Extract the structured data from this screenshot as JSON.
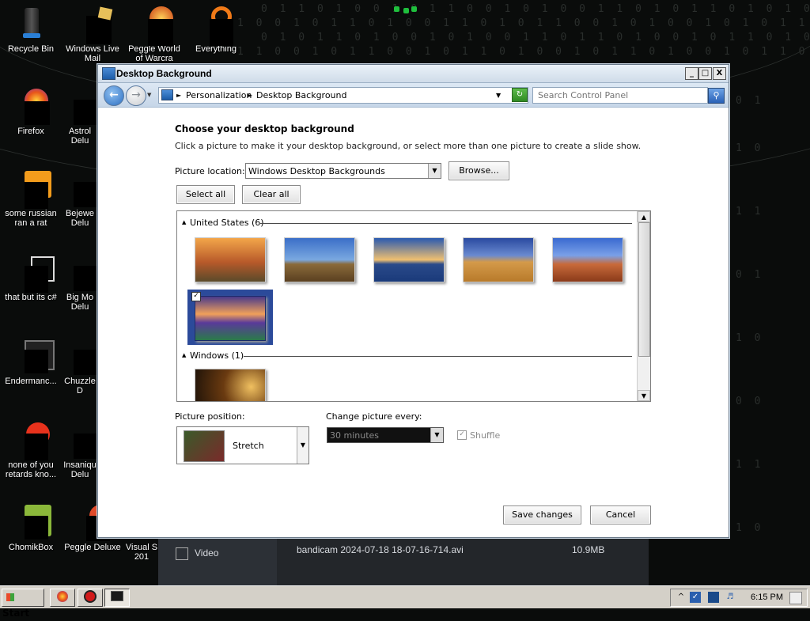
{
  "desktop": {
    "icons": [
      {
        "label": "Recycle Bin",
        "name": "recycle-bin-icon"
      },
      {
        "label": "Windows Live Mail",
        "name": "windows-live-mail-icon"
      },
      {
        "label": "Peggle World of Warcra",
        "name": "peggle-world-icon"
      },
      {
        "label": "Everything",
        "name": "everything-icon"
      },
      {
        "label": "Firefox",
        "name": "firefox-icon"
      },
      {
        "label": "Astrol Delu",
        "name": "astro-deluxe-icon"
      },
      {
        "label": "some russian ran a rat",
        "name": "russian-rat-icon"
      },
      {
        "label": "Bejewe Delu",
        "name": "bejeweled-icon"
      },
      {
        "label": "that but its c#",
        "name": "csharp-icon"
      },
      {
        "label": "Big Mo Delu",
        "name": "big-money-icon"
      },
      {
        "label": "Endermanc...",
        "name": "enderman-icon"
      },
      {
        "label": "Chuzzle D",
        "name": "chuzzle-icon"
      },
      {
        "label": "none of you retards kno...",
        "name": "none-of-you-icon"
      },
      {
        "label": "Insaniqu Delu",
        "name": "insaniquarium-icon"
      },
      {
        "label": "ChomikBox",
        "name": "chomikbox-icon"
      },
      {
        "label": "Peggle Deluxe",
        "name": "peggle-deluxe-icon"
      },
      {
        "label": "Visual S 201",
        "name": "visual-studio-icon"
      }
    ]
  },
  "window": {
    "title": "Desktop Background",
    "minimize": "_",
    "maximize": "□",
    "close": "X",
    "breadcrumb": [
      "Personalization",
      "Desktop Background"
    ],
    "search_placeholder": "Search Control Panel",
    "heading": "Choose your desktop background",
    "description": "Click a picture to make it your desktop background, or select more than one picture to create a slide show.",
    "picture_location_label": "Picture location:",
    "picture_location_value": "Windows Desktop Backgrounds",
    "browse_label": "Browse...",
    "select_all_label": "Select all",
    "clear_all_label": "Clear all",
    "groups": [
      {
        "label": "United States (6)"
      },
      {
        "label": "Windows (1)"
      }
    ],
    "picture_position_label": "Picture position:",
    "picture_position_value": "Stretch",
    "change_picture_label": "Change picture every:",
    "change_picture_value": "30 minutes",
    "shuffle_label": "Shuffle",
    "save_label": "Save changes",
    "cancel_label": "Cancel"
  },
  "media": {
    "category": "Video",
    "filename": "bandicam 2024-07-18 18-07-16-714.avi",
    "size": "10.9MB"
  },
  "taskbar": {
    "start_label": "Start",
    "clock": "6:15 PM"
  }
}
